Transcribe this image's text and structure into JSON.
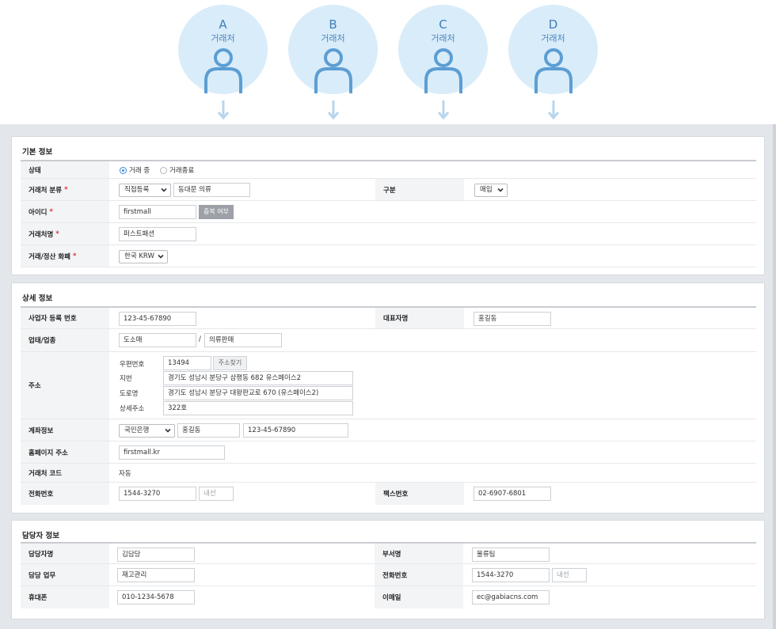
{
  "partners": [
    {
      "letter": "A",
      "label": "거래처"
    },
    {
      "letter": "B",
      "label": "거래처"
    },
    {
      "letter": "C",
      "label": "거래처"
    },
    {
      "letter": "D",
      "label": "거래처"
    }
  ],
  "colors": {
    "circle": "#d9ecfa",
    "accent": "#3f8ad8",
    "required": "#e0303a",
    "panel_bg": "#e3e6ea"
  },
  "basic": {
    "title": "기본 정보",
    "status": {
      "label": "상태",
      "option_active": "거래 중",
      "option_ended": "거래종료",
      "selected": "거래 중"
    },
    "category": {
      "label": "거래처 분류",
      "select_value": "직접등록",
      "input_value": "동대문 의류"
    },
    "division": {
      "label": "구분",
      "select_value": "매입"
    },
    "user_id": {
      "label": "아이디",
      "value": "firstmall",
      "check_button": "중복 여부"
    },
    "partner_name": {
      "label": "거래처명",
      "value": "퍼스트패션"
    },
    "currency": {
      "label": "거래/정산 화폐",
      "select_value": "한국 KRW"
    }
  },
  "detail": {
    "title": "상세 정보",
    "biz_no": {
      "label": "사업자 등록 번호",
      "value": "123-45-67890"
    },
    "ceo": {
      "label": "대표자명",
      "value": "홍길동"
    },
    "business": {
      "label": "업태/업종",
      "type": "도소매",
      "separator": "/",
      "item": "의류판매"
    },
    "address": {
      "label": "주소",
      "zip_label": "우편번호",
      "zip": "13494",
      "zip_button": "주소찾기",
      "jibun_label": "지번",
      "jibun": "경기도 성남시 분당구 삼평동 682 유스페이스2",
      "road_label": "도로명",
      "road": "경기도 성남시 분당구 대왕판교로 670 (유스페이스2)",
      "detail_label": "상세주소",
      "detail": "322호"
    },
    "account": {
      "label": "계좌정보",
      "bank": "국민은행",
      "holder": "홍길동",
      "number": "123-45-67890"
    },
    "homepage": {
      "label": "홈페이지 주소",
      "value": "firstmall.kr"
    },
    "code": {
      "label": "거래처 코드",
      "value": "자동"
    },
    "phone": {
      "label": "전화번호",
      "value": "1544-3270",
      "ext_placeholder": "내선"
    },
    "fax": {
      "label": "팩스번호",
      "value": "02-6907-6801"
    }
  },
  "manager": {
    "title": "담당자 정보",
    "name": {
      "label": "담당자명",
      "value": "김담당"
    },
    "dept": {
      "label": "부서명",
      "value": "물류팀"
    },
    "duty": {
      "label": "담당 업무",
      "value": "재고관리"
    },
    "phone": {
      "label": "전화번호",
      "value": "1544-3270",
      "ext_placeholder": "내선"
    },
    "mobile": {
      "label": "휴대폰",
      "value": "010-1234-5678"
    },
    "email": {
      "label": "이메일",
      "value": "ec@gabiacns.com"
    }
  }
}
